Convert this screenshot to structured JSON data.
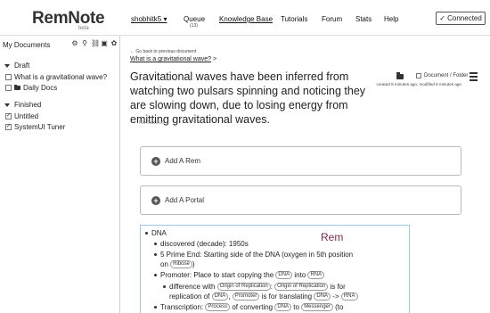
{
  "app": {
    "logo": "RemNote",
    "beta": "beta"
  },
  "nav": {
    "user": "shobhitk5 ▾",
    "queue": "Queue",
    "queue_count": "(13)",
    "knowledge_base": "Knowledge Base",
    "tutorials": "Tutorials",
    "forum": "Forum",
    "stats": "Stats",
    "help": "Help",
    "connected": "✓ Connected"
  },
  "sidebar": {
    "header": "My Documents",
    "icons": [
      "gear-icon",
      "search-icon",
      "link-icon",
      "trash-icon",
      "settings-icon"
    ],
    "sections": [
      {
        "title": "Draft",
        "items": [
          {
            "label": "What is a gravitational wave?",
            "checked": false,
            "kind": "checkbox"
          },
          {
            "label": "Daily Docs",
            "checked": false,
            "kind": "folder"
          }
        ]
      },
      {
        "title": "Finished",
        "items": [
          {
            "label": "Untitled",
            "checked": true,
            "kind": "checkbox"
          },
          {
            "label": "SystemUI Tuner",
            "checked": true,
            "kind": "checkbox"
          }
        ]
      }
    ]
  },
  "main": {
    "back_link": "← Go back to previous document",
    "breadcrumb": "What is a gravitational wave?",
    "breadcrumb_sep": ">",
    "title": "Gravitational waves have been inferred from watching two pulsars spinning and noticing they are slowing down, due to losing energy from emitting gravitational waves.",
    "no_source": "No Source",
    "doc_folder_label": "Document / Folder",
    "created": "created 8 minutes ago, modified 8 minutes ago",
    "add_rem": "Add A Rem",
    "add_portal": "Add A Portal",
    "rem_label": "Rem"
  },
  "rems": {
    "root": "DNA",
    "discovered": "discovered (decade): 1950s",
    "prime_end_1": "5 Prime End: Starting side of the DNA (oxygen in 5th position",
    "prime_end_on": "on",
    "prime_end_pill": "Ribose",
    "prime_end_close": ")",
    "promoter_a": "Promoter: Place to start copying the",
    "promoter_pill_dna": "DNA",
    "promoter_into": "into",
    "promoter_pill_rna": "RNA",
    "diff_a": "difference with",
    "diff_pill_1": "Origin of Replication",
    "diff_colon": ":",
    "diff_pill_2": "Origin of Replication",
    "diff_is_for": "is for",
    "diff_b": "replication of",
    "diff_pill_dna": "DNA",
    "diff_comma": ",",
    "diff_pill_promoter": "Promoter",
    "diff_translating": "is for translating",
    "diff_pill_dna2": "DNA",
    "diff_arrow": "->",
    "diff_pill_rna": "RNA",
    "trans_a": "Transcription:",
    "trans_pill_process": "Process",
    "trans_of": "of converting",
    "trans_pill_dna": "DNA",
    "trans_to": "to",
    "trans_pill_messenger": "Messenger",
    "trans_end": "(to"
  }
}
